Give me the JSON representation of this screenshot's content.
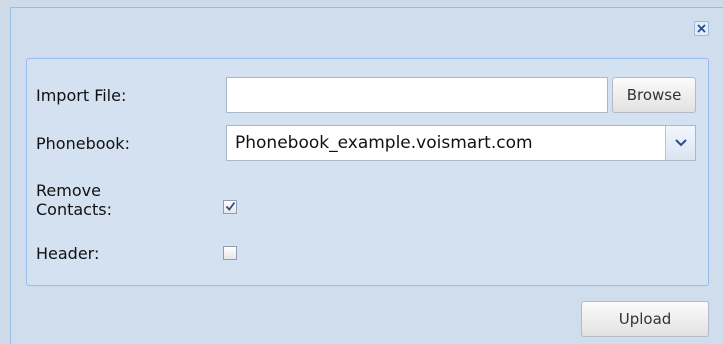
{
  "dialog": {
    "close_icon": "close-icon"
  },
  "form": {
    "import_file": {
      "label": "Import File:",
      "value": "",
      "browse_label": "Browse"
    },
    "phonebook": {
      "label": "Phonebook:",
      "selected": "Phonebook_example.voismart.com",
      "trigger_icon": "chevron-down-icon"
    },
    "remove_contacts": {
      "label_line1": "Remove",
      "label_line2": "Contacts:",
      "checked": true
    },
    "header": {
      "label": "Header:",
      "checked": false
    }
  },
  "footer": {
    "upload_label": "Upload"
  },
  "colors": {
    "window_bg": "#d0dded",
    "panel_border": "#99bbe8",
    "check_color": "#2a4b8d"
  }
}
